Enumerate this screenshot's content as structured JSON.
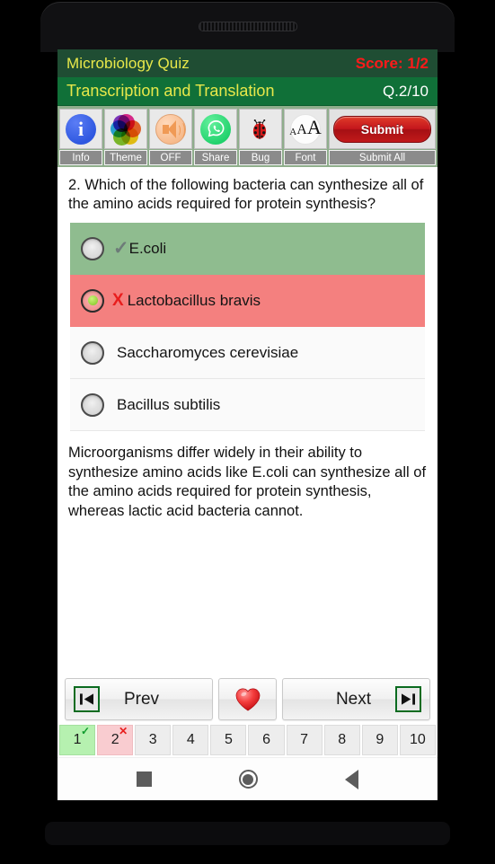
{
  "app": {
    "title": "Microbiology Quiz",
    "score": "Score: 1/2",
    "chapter": "Transcription and Translation",
    "question_counter": "Q.2/10"
  },
  "toolbar": {
    "buttons": [
      {
        "label": "Info",
        "icon": "info-icon"
      },
      {
        "label": "Theme",
        "icon": "theme-palette-icon"
      },
      {
        "label": "OFF",
        "icon": "sound-off-icon"
      },
      {
        "label": "Share",
        "icon": "whatsapp-share-icon"
      },
      {
        "label": "Bug",
        "icon": "ladybug-icon"
      },
      {
        "label": "Font",
        "icon": "font-size-icon"
      },
      {
        "label": "Submit All",
        "icon": "submit-button",
        "button_text": "Submit"
      }
    ]
  },
  "question": {
    "text": "2. Which of the following bacteria can synthesize all of the amino acids required for protein synthesis?",
    "options": [
      {
        "label": "E.coli",
        "state": "correct",
        "mark": "✓",
        "selected": false
      },
      {
        "label": "Lactobacillus bravis",
        "state": "wrong",
        "mark": "X",
        "selected": true
      },
      {
        "label": "Saccharomyces cerevisiae",
        "state": "neutral",
        "mark": "",
        "selected": false
      },
      {
        "label": "Bacillus subtilis",
        "state": "neutral",
        "mark": "",
        "selected": false
      }
    ],
    "explanation": "Microorganisms differ widely in their ability to synthesize amino acids like E.coli can synthesize all of the amino acids required for protein synthesis, whereas lactic acid bacteria cannot."
  },
  "nav": {
    "prev_label": "Prev",
    "next_label": "Next",
    "favorite_icon": "heart-icon",
    "prev_icon": "skip-previous-icon",
    "next_icon": "skip-next-icon"
  },
  "pagination": {
    "pages": [
      {
        "number": "1",
        "state": "ok",
        "badge": "✓"
      },
      {
        "number": "2",
        "state": "bad",
        "badge": "✕"
      },
      {
        "number": "3",
        "state": "neutral",
        "badge": ""
      },
      {
        "number": "4",
        "state": "neutral",
        "badge": ""
      },
      {
        "number": "5",
        "state": "neutral",
        "badge": ""
      },
      {
        "number": "6",
        "state": "neutral",
        "badge": ""
      },
      {
        "number": "7",
        "state": "neutral",
        "badge": ""
      },
      {
        "number": "8",
        "state": "neutral",
        "badge": ""
      },
      {
        "number": "9",
        "state": "neutral",
        "badge": ""
      },
      {
        "number": "10",
        "state": "neutral",
        "badge": ""
      }
    ]
  },
  "system_nav": {
    "recents_icon": "square-recents-icon",
    "home_icon": "circle-home-icon",
    "back_icon": "triangle-back-icon"
  },
  "colors": {
    "header_dark_green": "#1f4d33",
    "header_green": "#107038",
    "title_yellow": "#e8e84a",
    "score_red": "#ff1a1a",
    "toolbar_bg": "#8fae8c",
    "correct_green": "#8fbc8f",
    "wrong_red": "#f4807f",
    "page_ok_green": "#b6f1b0",
    "page_bad_pink": "#f9ccd0",
    "submit_red": "#c4161c"
  }
}
